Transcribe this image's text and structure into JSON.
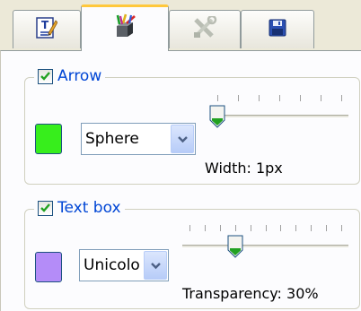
{
  "tabs": [
    {
      "name": "text-edit",
      "icon": "text-edit-icon",
      "active": false
    },
    {
      "name": "style-paint",
      "icon": "paint-box-icon",
      "active": true
    },
    {
      "name": "tools",
      "icon": "tools-icon",
      "active": false,
      "disabled": true
    },
    {
      "name": "save",
      "icon": "save-icon",
      "active": false
    }
  ],
  "arrow": {
    "checked": true,
    "label": "Arrow",
    "color": "#37ee1c",
    "style_value": "Sphere",
    "width_caption": "Width: 1px",
    "slider_position": 0.0,
    "tick_count": 7
  },
  "textbox": {
    "checked": true,
    "label": "Text box",
    "color": "#b48cf8",
    "style_value": "Unicolor",
    "transparency_caption": "Transparency: 30%",
    "transparency_percent": 30,
    "tick_count": 11
  },
  "colors": {
    "accent_tab": "#ffc83c",
    "legend_text": "#0046d5",
    "panel_bg": "#fcfcfe"
  }
}
